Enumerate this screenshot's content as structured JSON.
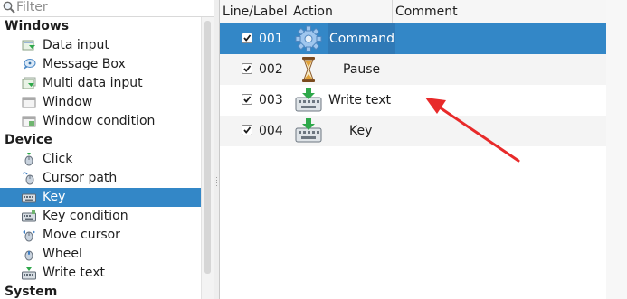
{
  "filter": {
    "placeholder": "Filter"
  },
  "tree": {
    "categories": [
      {
        "label": "Windows",
        "items": [
          {
            "label": "Data input",
            "icon": "data-input-icon"
          },
          {
            "label": "Message Box",
            "icon": "message-box-icon"
          },
          {
            "label": "Multi data input",
            "icon": "multi-data-input-icon"
          },
          {
            "label": "Window",
            "icon": "window-icon"
          },
          {
            "label": "Window condition",
            "icon": "window-condition-icon"
          }
        ]
      },
      {
        "label": "Device",
        "items": [
          {
            "label": "Click",
            "icon": "mouse-icon"
          },
          {
            "label": "Cursor path",
            "icon": "mouse-path-icon"
          },
          {
            "label": "Key",
            "icon": "keyboard-icon",
            "selected": true
          },
          {
            "label": "Key condition",
            "icon": "keyboard-condition-icon"
          },
          {
            "label": "Move cursor",
            "icon": "mouse-move-icon"
          },
          {
            "label": "Wheel",
            "icon": "mouse-wheel-icon"
          },
          {
            "label": "Write text",
            "icon": "keyboard-text-icon"
          }
        ]
      },
      {
        "label": "System",
        "items": []
      }
    ]
  },
  "table": {
    "columns": [
      "Line/Label",
      "Action",
      "Comment"
    ],
    "rows": [
      {
        "checked": true,
        "line": "001",
        "action": "Command",
        "icon": "gear-icon",
        "comment": "",
        "selected": true
      },
      {
        "checked": true,
        "line": "002",
        "action": "Pause",
        "icon": "hourglass-icon",
        "comment": ""
      },
      {
        "checked": true,
        "line": "003",
        "action": "Write text",
        "icon": "keyboard-arrow-icon",
        "comment": ""
      },
      {
        "checked": true,
        "line": "004",
        "action": "Key",
        "icon": "keyboard-arrow-icon",
        "comment": ""
      }
    ]
  },
  "colors": {
    "selection": "#3387c7",
    "annotation_arrow": "#e82a2a"
  }
}
